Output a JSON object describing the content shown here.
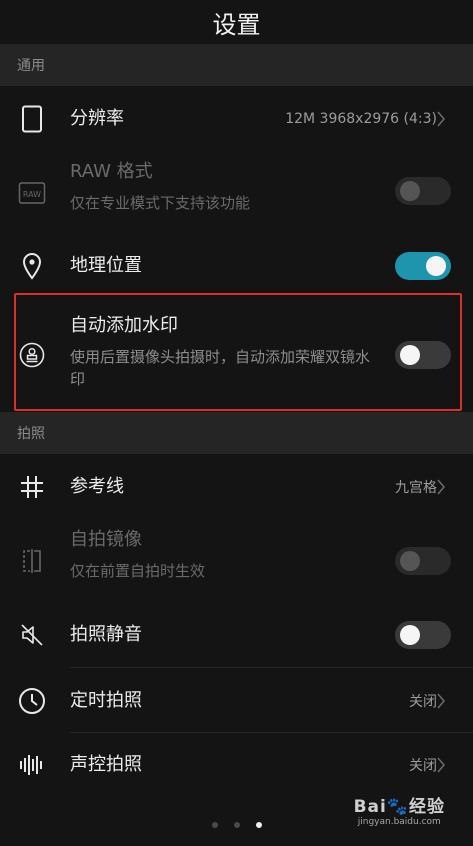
{
  "header": {
    "title": "设置"
  },
  "sections": {
    "general": "通用",
    "camera": "拍照"
  },
  "general": {
    "resolution": {
      "title": "分辨率",
      "value": "12M 3968x2976 (4:3)"
    },
    "raw": {
      "title": "RAW 格式",
      "sub": "仅在专业模式下支持该功能",
      "toggle": "off-disabled"
    },
    "location": {
      "title": "地理位置",
      "toggle": "on"
    },
    "watermark": {
      "title": "自动添加水印",
      "sub": "使用后置摄像头拍摄时，自动添加荣耀双镜水印",
      "toggle": "off"
    }
  },
  "camera": {
    "gridlines": {
      "title": "参考线",
      "value": "九宫格"
    },
    "mirror": {
      "title": "自拍镜像",
      "sub": "仅在前置自拍时生效",
      "toggle": "off-disabled"
    },
    "mute": {
      "title": "拍照静音",
      "toggle": "off"
    },
    "timer": {
      "title": "定时拍照",
      "value": "关闭"
    },
    "voice": {
      "title": "声控拍照",
      "value": "关闭"
    }
  },
  "page_indicator": {
    "count": 3,
    "active": 3
  },
  "watermark_logo": {
    "brand": "Bai🐾经验",
    "url": "jingyan.baidu.com"
  },
  "colors": {
    "accent": "#1e95ad",
    "highlight": "#d8302a",
    "background": "#141414"
  }
}
